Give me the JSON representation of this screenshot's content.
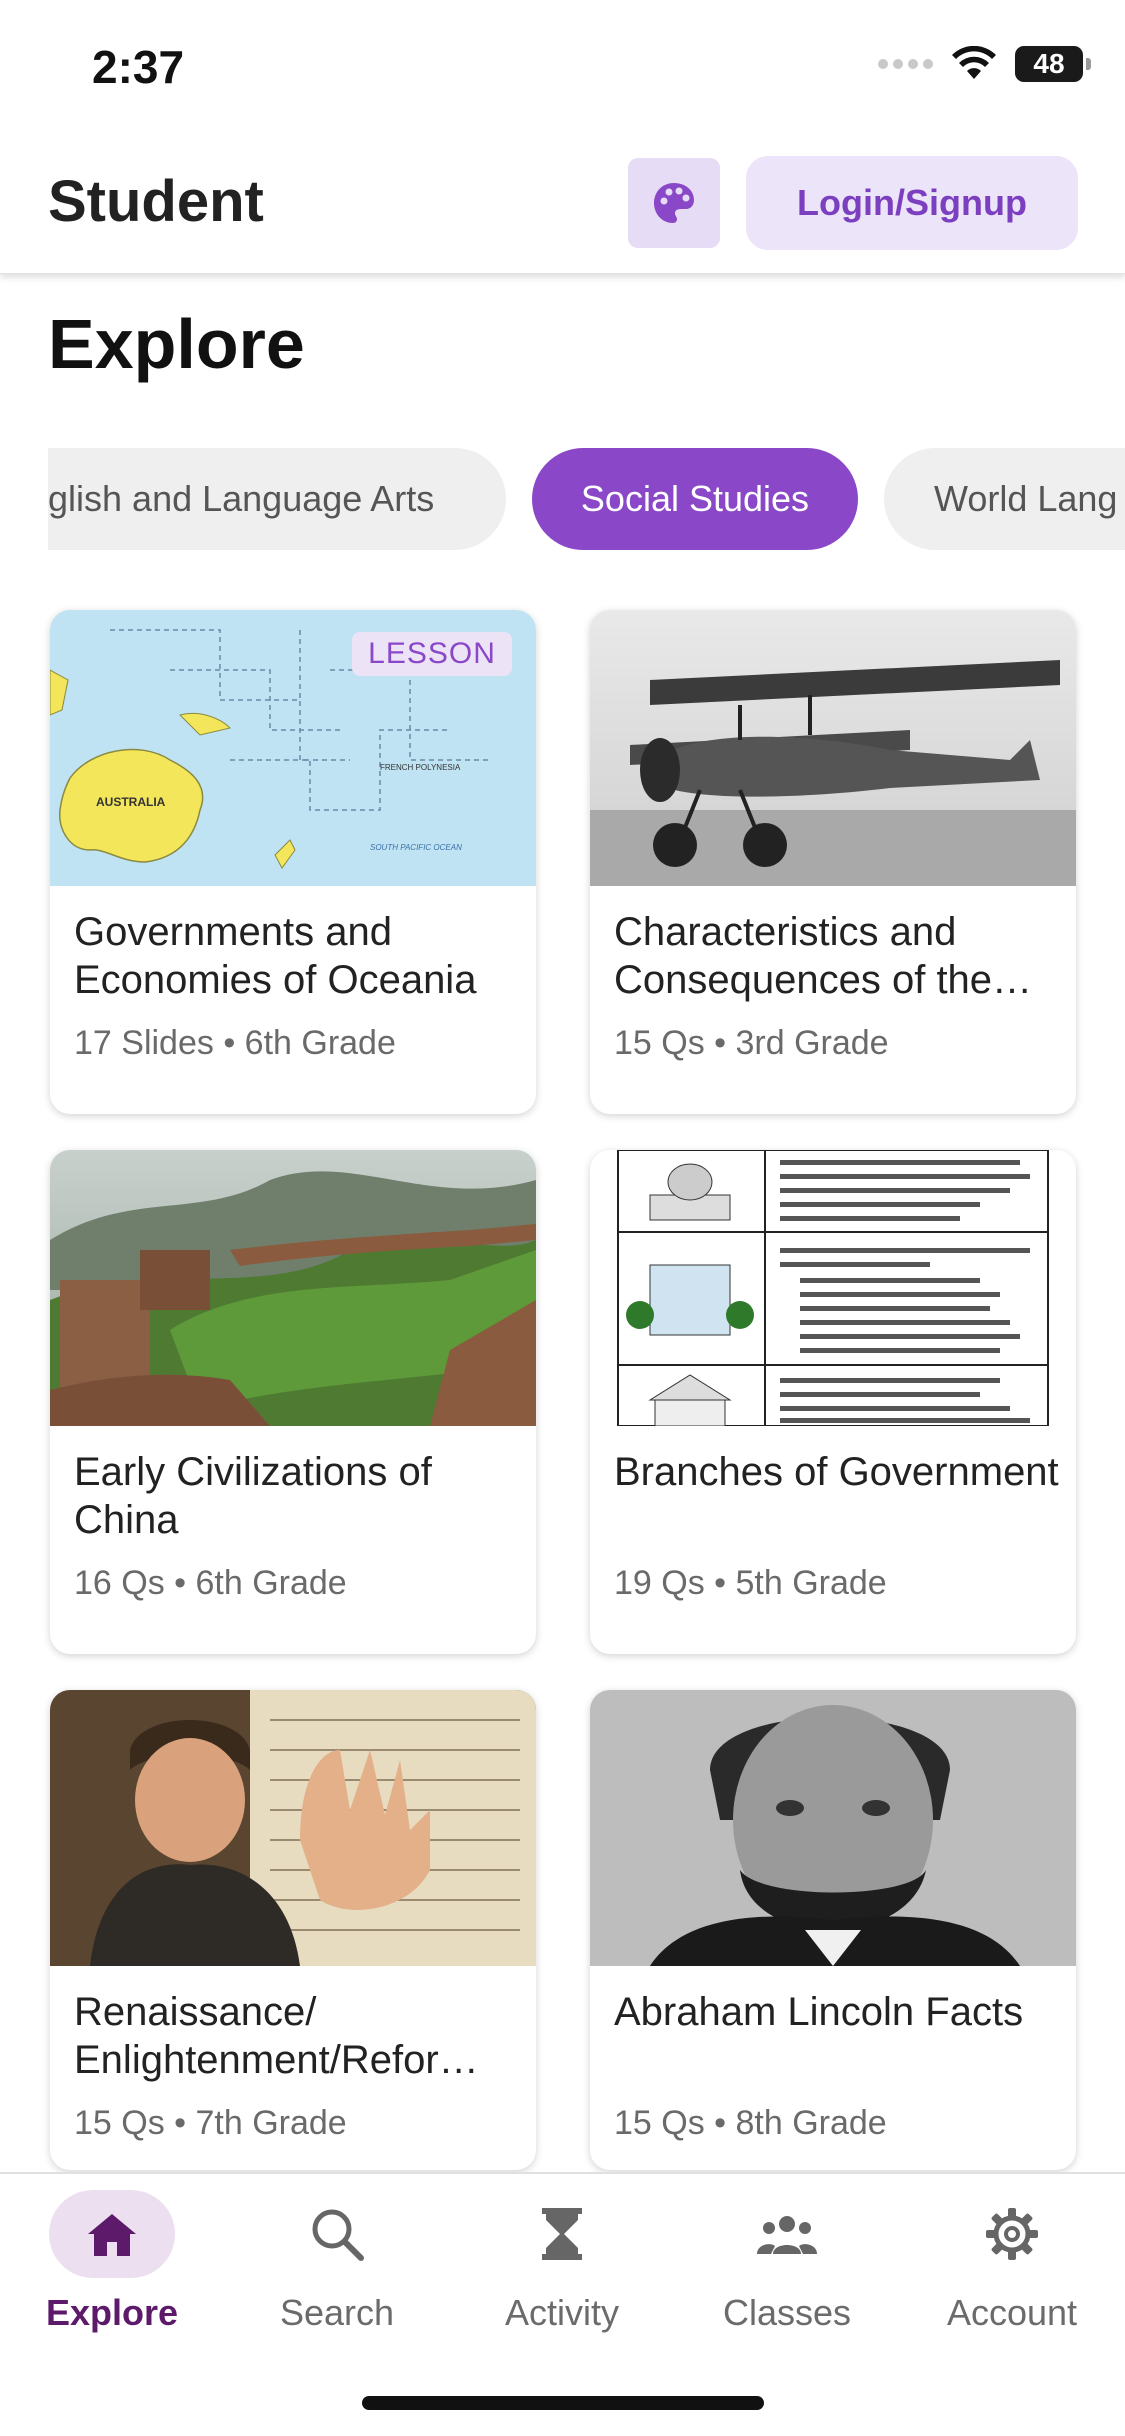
{
  "status_bar": {
    "time": "2:37",
    "battery": "48"
  },
  "app_bar": {
    "title": "Student",
    "login_label": "Login/Signup"
  },
  "explore": {
    "title": "Explore",
    "chips": [
      {
        "label": "glish and Language Arts",
        "selected": false
      },
      {
        "label": "Social Studies",
        "selected": true
      },
      {
        "label": "World Lang",
        "selected": false
      }
    ]
  },
  "cards": [
    {
      "title": "Governments and Economies of Oceania",
      "meta": "17 Slides • 6th Grade",
      "badge": "LESSON",
      "image": "map-oceania"
    },
    {
      "title": "Characteristics and Consequences of the…",
      "meta": "15 Qs • 3rd Grade",
      "image": "biplane-photo"
    },
    {
      "title": "Early Civilizations of China",
      "meta": "16 Qs • 6th Grade",
      "image": "great-wall-photo"
    },
    {
      "title": "Branches of Government",
      "meta": "19 Qs • 5th Grade",
      "image": "government-branches-chart"
    },
    {
      "title": "Renaissance/ Enlightenment/Refor…",
      "meta": "15 Qs • 7th Grade",
      "image": "luther-painting"
    },
    {
      "title": "Abraham Lincoln Facts",
      "meta": "15 Qs • 8th Grade",
      "image": "lincoln-portrait"
    }
  ],
  "bottom_nav": [
    {
      "label": "Explore",
      "icon": "home-icon",
      "active": true
    },
    {
      "label": "Search",
      "icon": "search-icon",
      "active": false
    },
    {
      "label": "Activity",
      "icon": "hourglass-icon",
      "active": false
    },
    {
      "label": "Classes",
      "icon": "people-icon",
      "active": false
    },
    {
      "label": "Account",
      "icon": "gear-icon",
      "active": false
    }
  ],
  "colors": {
    "accent": "#8a48c8",
    "accent_light": "#ece4f8",
    "nav_active": "#5d1a6a"
  }
}
